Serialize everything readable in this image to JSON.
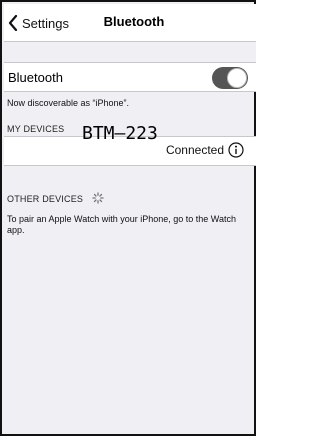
{
  "navbar": {
    "back_label": "Settings",
    "title": "Bluetooth"
  },
  "bluetooth": {
    "label": "Bluetooth",
    "enabled": true,
    "discoverable_text": "Now discoverable as “iPhone”."
  },
  "my_devices": {
    "header": "MY DEVICES",
    "items": [
      {
        "name": "BTM—223",
        "status": "Connected"
      }
    ]
  },
  "other_devices": {
    "header": "OTHER DEVICES",
    "pair_text": "To pair an Apple Watch with your iPhone, go to the Watch app."
  },
  "icons": {
    "back": "chevron-left-icon",
    "info": "info-icon",
    "spinner": "spinner-icon"
  }
}
